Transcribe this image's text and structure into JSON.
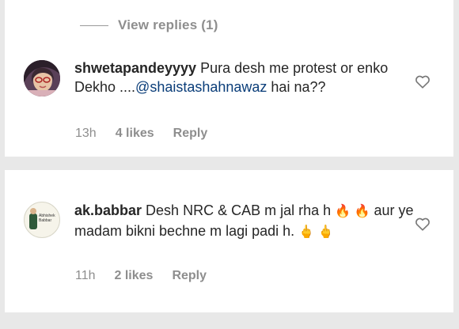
{
  "comment1": {
    "view_replies": "View replies (1)",
    "username": "shwetapandeyyyy",
    "text_part1": " Pura desh me protest or enko Dekho ....",
    "mention": "@shaistashahnawaz",
    "text_part2": " hai na??",
    "time": "13h",
    "likes": "4 likes",
    "reply": "Reply"
  },
  "comment2": {
    "username": "ak.babbar",
    "text_part1": " Desh NRC & CAB m jal rha h",
    "fire_emojis": "🔥 🔥",
    "text_part2": " aur ye madam bikni bechne m lagi padi h. ",
    "finger_emojis": "🖕 🖕",
    "avatar_text": "Abhishek Babbar",
    "time": "11h",
    "likes": "2 likes",
    "reply": "Reply"
  },
  "icons": {
    "like": "heart-outline-icon"
  }
}
